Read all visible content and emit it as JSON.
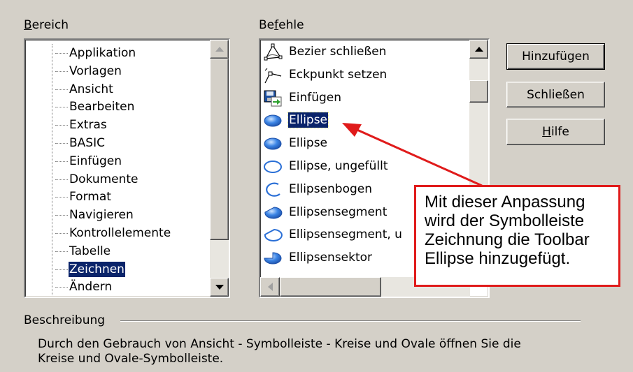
{
  "bereich": {
    "label_accel": "B",
    "label_rest": "ereich",
    "items": [
      {
        "label": "Applikation"
      },
      {
        "label": "Vorlagen"
      },
      {
        "label": "Ansicht"
      },
      {
        "label": "Bearbeiten"
      },
      {
        "label": "Extras"
      },
      {
        "label": "BASIC"
      },
      {
        "label": "Einfügen"
      },
      {
        "label": "Dokumente"
      },
      {
        "label": "Format"
      },
      {
        "label": "Navigieren"
      },
      {
        "label": "Kontrollelemente"
      },
      {
        "label": "Tabelle"
      },
      {
        "label": "Zeichnen"
      },
      {
        "label": "Ändern"
      }
    ],
    "selected": "Zeichnen"
  },
  "befehle": {
    "label_pre": "Be",
    "label_accel": "f",
    "label_rest": "ehle",
    "items": [
      {
        "label": "Bezier schließen",
        "icon": "bezier-close-icon"
      },
      {
        "label": "Eckpunkt setzen",
        "icon": "corner-point-icon"
      },
      {
        "label": "Einfügen",
        "icon": "insert-icon"
      },
      {
        "label": "Ellipse",
        "icon": "ellipse-filled-icon"
      },
      {
        "label": "Ellipse",
        "icon": "ellipse-filled-icon"
      },
      {
        "label": "Ellipse, ungefüllt",
        "icon": "ellipse-unfilled-icon"
      },
      {
        "label": "Ellipsenbogen",
        "icon": "ellipse-arc-icon"
      },
      {
        "label": "Ellipsensegment",
        "icon": "ellipse-segment-icon"
      },
      {
        "label": "Ellipsensegment, u",
        "icon": "ellipse-segment-unfilled-icon"
      },
      {
        "label": "Ellipsensektor",
        "icon": "ellipse-sector-icon"
      }
    ],
    "selected_index": 3
  },
  "buttons": {
    "add": "Hinzufügen",
    "close": "Schließen",
    "help_accel": "H",
    "help_rest": "ilfe"
  },
  "callout": {
    "lines": [
      "Mit dieser Anpassung",
      "wird der Symbolleiste",
      "Zeichnung die Toolbar",
      "Ellipse hinzugefügt."
    ]
  },
  "beschreibung": {
    "label": "Beschreibung",
    "text_line1": "Durch den Gebrauch von Ansicht - Symbolleiste - Kreise und Ovale öffnen Sie die",
    "text_line2": "Kreise und Ovale-Symbolleiste."
  },
  "colors": {
    "dialog_bg": "#d4d0c8",
    "selection": "#0a246a",
    "annotation_red": "#e01b1b"
  }
}
